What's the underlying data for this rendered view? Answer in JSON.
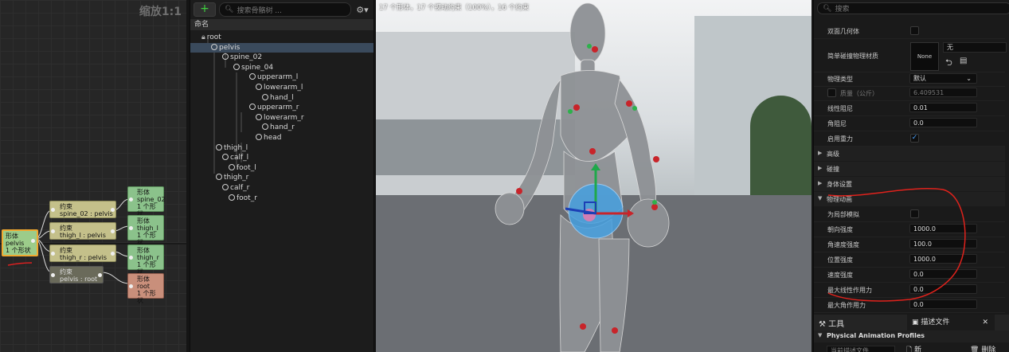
{
  "graph": {
    "zoom_label": "缩放1:1",
    "nodes": {
      "body_pelvis": {
        "type": "形体",
        "name": "pelvis",
        "shapes": "1 个形状"
      },
      "con_spine02": {
        "type": "约束",
        "name": "spine_02 : pelvis"
      },
      "con_thighl": {
        "type": "约束",
        "name": "thigh_l : pelvis"
      },
      "con_thighr": {
        "type": "约束",
        "name": "thigh_r : pelvis"
      },
      "con_root": {
        "type": "约束",
        "name": "pelvis : root"
      },
      "body_spine02": {
        "type": "形体",
        "name": "spine_02",
        "shapes": "1 个形状"
      },
      "body_thighl": {
        "type": "形体",
        "name": "thigh_l",
        "shapes": "1 个形状"
      },
      "body_thighr": {
        "type": "形体",
        "name": "thigh_r",
        "shapes": "1 个形状"
      },
      "body_root": {
        "type": "形体",
        "name": "root",
        "shapes": "1 个形状"
      }
    }
  },
  "tree": {
    "add_label": "+",
    "search_placeholder": "搜索骨骼树 ...",
    "column_header": "命名",
    "bones": [
      "root",
      "pelvis",
      "spine_02",
      "spine_04",
      "upperarm_l",
      "lowerarm_l",
      "hand_l",
      "upperarm_r",
      "lowerarm_r",
      "hand_r",
      "head",
      "thigh_l",
      "calf_l",
      "foot_l",
      "thigh_r",
      "calf_r",
      "foot_r"
    ],
    "selected": "pelvis"
  },
  "viewport": {
    "stats": "17 个形体，17 个视动约束（100%），16 个约束"
  },
  "details": {
    "search_placeholder": "搜索",
    "double_sided": "双面几何体",
    "simple_collision_material": "简单碰撞物理材质",
    "material_thumb": "None",
    "material_value": "无",
    "physics_type_label": "物理类型",
    "physics_type_value": "默认",
    "mass_label": "质量（公斤）",
    "mass_value": "6.409531",
    "linear_damping_label": "线性阻尼",
    "linear_damping_value": "0.01",
    "angular_damping_label": "角阻尼",
    "angular_damping_value": "0.0",
    "enable_gravity_label": "启用重力",
    "cat_advanced": "高级",
    "cat_collision": "碰撞",
    "cat_body_setup": "身体设置",
    "cat_physical_animation": "物理动画",
    "local_sim_label": "为局部模拟",
    "orient_strength_label": "朝向强度",
    "orient_strength_value": "1000.0",
    "ang_vel_strength_label": "角速度强度",
    "ang_vel_strength_value": "100.0",
    "pos_strength_label": "位置强度",
    "pos_strength_value": "1000.0",
    "vel_strength_label": "速度强度",
    "vel_strength_value": "0.0",
    "max_linear_force_label": "最大线性作用力",
    "max_linear_force_value": "0.0",
    "max_angular_force_label": "最大角作用力",
    "max_angular_force_value": "0.0",
    "tools_tab": "工具",
    "profile_tab": "描述文件",
    "profiles_header": "Physical Animation Profiles",
    "current_profile": "当前描述文件",
    "new_label": "新",
    "delete_label": "删除"
  }
}
